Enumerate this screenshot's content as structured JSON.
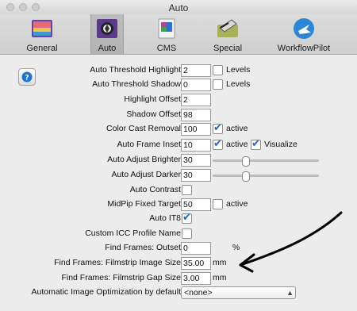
{
  "window": {
    "title": "Auto"
  },
  "toolbar": {
    "tabs": [
      {
        "label": "General",
        "icon": "general-icon"
      },
      {
        "label": "Auto",
        "icon": "auto-icon"
      },
      {
        "label": "CMS",
        "icon": "cms-icon"
      },
      {
        "label": "Special",
        "icon": "special-icon"
      },
      {
        "label": "WorkflowPilot",
        "icon": "workflowpilot-icon"
      }
    ],
    "selected": "Auto"
  },
  "settings": {
    "auto_threshold_highlight": {
      "label": "Auto Threshold Highlight",
      "value": "2",
      "check_label": "Levels"
    },
    "auto_threshold_shadow": {
      "label": "Auto Threshold Shadow",
      "value": "0",
      "check_label": "Levels"
    },
    "highlight_offset": {
      "label": "Highlight Offset",
      "value": "2"
    },
    "shadow_offset": {
      "label": "Shadow Offset",
      "value": "98"
    },
    "color_cast_removal": {
      "label": "Color Cast Removal",
      "value": "100",
      "check_label": "active"
    },
    "auto_frame_inset": {
      "label": "Auto Frame Inset",
      "value": "10",
      "check_label": "active",
      "check2_label": "Visualize"
    },
    "auto_adjust_brighter": {
      "label": "Auto Adjust Brighter",
      "value": "30",
      "slider_level": 0.3
    },
    "auto_adjust_darker": {
      "label": "Auto Adjust Darker",
      "value": "30",
      "slider_level": 0.3
    },
    "auto_contrast": {
      "label": "Auto Contrast"
    },
    "midpip_fixed_target": {
      "label": "MidPip Fixed Target",
      "value": "50",
      "check_label": "active"
    },
    "auto_it8": {
      "label": "Auto IT8"
    },
    "custom_icc_profile_name": {
      "label": "Custom ICC Profile Name"
    },
    "find_frames_outset": {
      "label": "Find Frames: Outset",
      "value": "0",
      "unit": "%"
    },
    "find_frames_filmstrip_image_size": {
      "label": "Find Frames: Filmstrip Image Size",
      "value": "35.00",
      "unit": "mm"
    },
    "find_frames_filmstrip_gap_size": {
      "label": "Find Frames: Filmstrip Gap Size",
      "value": "3.00",
      "unit": "mm"
    },
    "automatic_image_optimization": {
      "label": "Automatic Image Optimization by default",
      "value": "<none>"
    }
  },
  "colors": {
    "accent": "#1463d6"
  }
}
